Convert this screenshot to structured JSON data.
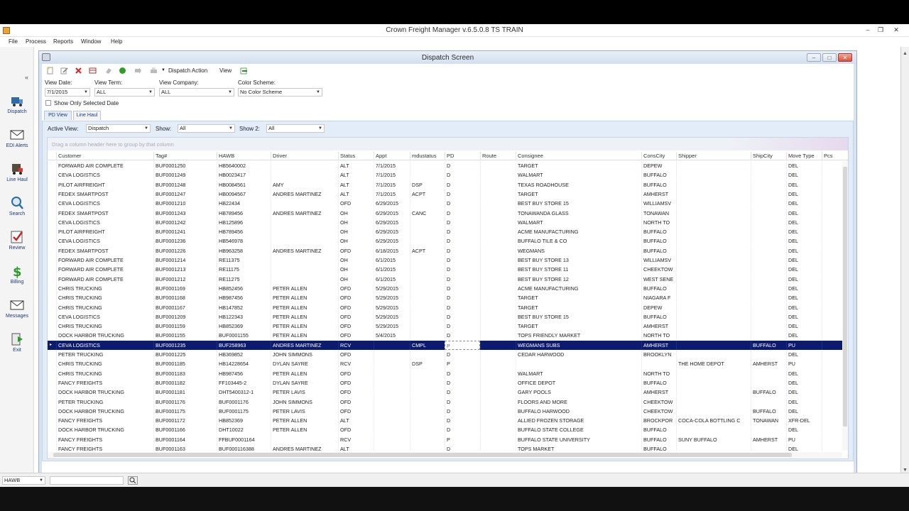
{
  "app": {
    "title": "Crown Freight Manager v.6.5.0.8 TS TRAIN",
    "menu": [
      "File",
      "Process",
      "Reports",
      "Window",
      "Help"
    ]
  },
  "sidebar": {
    "items": [
      {
        "label": "Dispatch",
        "icon": "dispatch-truck-icon"
      },
      {
        "label": "EDI Alerts",
        "icon": "envelope-icon"
      },
      {
        "label": "Line Haul",
        "icon": "line-haul-icon"
      },
      {
        "label": "Search",
        "icon": "search-icon"
      },
      {
        "label": "Review",
        "icon": "checklist-icon"
      },
      {
        "label": "Billing",
        "icon": "dollar-icon"
      },
      {
        "label": "Messages",
        "icon": "envelope-icon"
      },
      {
        "label": "Exit",
        "icon": "exit-icon"
      }
    ]
  },
  "dispatch": {
    "title": "Dispatch Screen",
    "toolbar": {
      "dispatch_action": "Dispatch Action",
      "view": "View"
    },
    "filters": {
      "view_date_label": "View Date:",
      "view_date": "7/1/2015",
      "view_term_label": "View Term:",
      "view_term": "ALL",
      "view_company_label": "View Company:",
      "view_company": "ALL",
      "color_scheme_label": "Color Scheme:",
      "color_scheme": "No Color Scheme",
      "show_only_selected": "Show Only Selected Date"
    },
    "tabs": [
      "PD View",
      "Line Haul"
    ],
    "active_view_label": "Active View:",
    "active_view": "Dispatch",
    "show_label": "Show:",
    "show": "All",
    "show2_label": "Show 2:",
    "show2": "All",
    "group_hint": "Drag a column header here to group by that column",
    "columns": [
      "Customer",
      "Tag#",
      "HAWB",
      "Driver",
      "Status",
      "Appt",
      "mdustatus",
      "PD",
      "Route",
      "Consignee",
      "ConsCity",
      "Shipper",
      "ShipCity",
      "Move Type",
      "Pcs"
    ],
    "rows": [
      [
        "FORWARD AIR COMPLETE",
        "BUF0001250",
        "HB5640002",
        "",
        "ALT",
        "7/1/2015",
        "",
        "D",
        "",
        "TARGET",
        "DEPEW",
        "",
        "",
        "DEL",
        ""
      ],
      [
        "CEVA LOGISTICS",
        "BUF0001249",
        "HB0023417",
        "",
        "ALT",
        "7/1/2015",
        "",
        "D",
        "",
        "WALMART",
        "BUFFALO",
        "",
        "",
        "DEL",
        ""
      ],
      [
        "PILOT AIRFREIGHT",
        "BUF0001248",
        "HB0084561",
        "AMY",
        "ALT",
        "7/1/2015",
        "DSP",
        "D",
        "",
        "TEXAS ROADHOUSE",
        "BUFFALO",
        "",
        "",
        "DEL",
        ""
      ],
      [
        "FEDEX SMARTPOST",
        "BUF0001247",
        "HB0094567",
        "ANDRES MARTINEZ",
        "ALT",
        "7/1/2015",
        "ACPT",
        "D",
        "",
        "TARGET",
        "AMHERST",
        "",
        "",
        "DEL",
        ""
      ],
      [
        "CEVA LOGISTICS",
        "BUF0001210",
        "HB22434",
        "",
        "OFD",
        "6/29/2015",
        "",
        "D",
        "",
        "BEST BUY STORE 15",
        "WILLIAMSV",
        "",
        "",
        "DEL",
        ""
      ],
      [
        "FEDEX SMARTPOST",
        "BUF0001243",
        "HB789456",
        "ANDRES MARTINEZ",
        "OH",
        "6/29/2015",
        "CANC",
        "D",
        "",
        "TONAWANDA GLASS",
        "TONAWAN",
        "",
        "",
        "DEL",
        ""
      ],
      [
        "CEVA LOGISTICS",
        "BUF0001242",
        "HB125896",
        "",
        "OH",
        "6/29/2015",
        "",
        "D",
        "",
        "WALMART",
        "NORTH TO",
        "",
        "",
        "DEL",
        ""
      ],
      [
        "PILOT AIRFREIGHT",
        "BUF0001241",
        "HB789456",
        "",
        "OH",
        "6/29/2015",
        "",
        "D",
        "",
        "ACME MANUFACTURING",
        "BUFFALO",
        "",
        "",
        "DEL",
        ""
      ],
      [
        "CEVA LOGISTICS",
        "BUF0001236",
        "HB546978",
        "",
        "OH",
        "6/29/2015",
        "",
        "D",
        "",
        "BUFFALO TILE & CO",
        "BUFFALO",
        "",
        "",
        "DEL",
        ""
      ],
      [
        "FEDEX SMARTPOST",
        "BUF0001226",
        "HB963258",
        "ANDRES MARTINEZ",
        "OFD",
        "6/18/2015",
        "ACPT",
        "D",
        "",
        "WEGMANS",
        "BUFFALO",
        "",
        "",
        "DEL",
        ""
      ],
      [
        "FORWARD AIR COMPLETE",
        "BUF0001214",
        "RE11375",
        "",
        "OH",
        "6/1/2015",
        "",
        "D",
        "",
        "BEST BUY STORE 13",
        "WILLIAMSV",
        "",
        "",
        "DEL",
        ""
      ],
      [
        "FORWARD AIR COMPLETE",
        "BUF0001213",
        "RE11175",
        "",
        "OH",
        "6/1/2015",
        "",
        "D",
        "",
        "BEST BUY STORE 11",
        "CHEEKTOW",
        "",
        "",
        "DEL",
        ""
      ],
      [
        "FORWARD AIR COMPLETE",
        "BUF0001212",
        "RE11275",
        "",
        "OH",
        "6/1/2015",
        "",
        "D",
        "",
        "BEST BUY STORE 12",
        "WEST SENE",
        "",
        "",
        "DEL",
        ""
      ],
      [
        "CHRIS TRUCKING",
        "BUF0001169",
        "HB852456",
        "PETER ALLEN",
        "OFD",
        "5/29/2015",
        "",
        "D",
        "",
        "ACME MANUFACTURING",
        "BUFFALO",
        "",
        "",
        "DEL",
        ""
      ],
      [
        "CHRIS TRUCKING",
        "BUF0001168",
        "HB987456",
        "PETER ALLEN",
        "OFD",
        "5/29/2015",
        "",
        "D",
        "",
        "TARGET",
        "NIAGARA F",
        "",
        "",
        "DEL",
        ""
      ],
      [
        "CHRIS TRUCKING",
        "BUF0001167",
        "HB147852",
        "PETER ALLEN",
        "OFD",
        "5/29/2015",
        "",
        "D",
        "",
        "TARGET",
        "DEPEW",
        "",
        "",
        "DEL",
        ""
      ],
      [
        "CEVA LOGISTICS",
        "BUF0001209",
        "HB122343",
        "PETER ALLEN",
        "OFD",
        "5/29/2015",
        "",
        "D",
        "",
        "BEST BUY STORE 15",
        "BUFFALO",
        "",
        "",
        "DEL",
        ""
      ],
      [
        "CHRIS TRUCKING",
        "BUF0001159",
        "HB852369",
        "PETER ALLEN",
        "OFD",
        "5/29/2015",
        "",
        "D",
        "",
        "TARGET",
        "AMHERST",
        "",
        "",
        "DEL",
        ""
      ],
      [
        "DOCK HARBOR TRUCKING",
        "BUF0001155",
        "BUF0001155",
        "PETER ALLEN",
        "OFD",
        "5/4/2015",
        "",
        "D",
        "",
        "TOPS FRIENDLY MARKET",
        "NORTH TO",
        "",
        "",
        "DEL",
        ""
      ],
      [
        "CEVA LOGISTICS",
        "BUF0001235",
        "BUF258963",
        "ANDRES MARTINEZ",
        "RCV",
        "",
        "CMPL",
        "P",
        "",
        "WEGMANS SUBS",
        "AMHERST",
        "",
        "BUFFALO",
        "PU",
        ""
      ],
      [
        "PETER TRUCKING",
        "BUF0001225",
        "HB369852",
        "JOHN SIMMONS",
        "OFD",
        "",
        "",
        "D",
        "",
        "CEDAR HARWOOD",
        "BROOKLYN",
        "",
        "",
        "DEL",
        ""
      ],
      [
        "CHRIS TRUCKING",
        "BUF0001185",
        "HB14228654",
        "DYLAN SAYRE",
        "RCV",
        "",
        "DSP",
        "P",
        "",
        "",
        "",
        "THE HOME DEPOT",
        "AMHERST",
        "PU",
        ""
      ],
      [
        "CHRIS TRUCKING",
        "BUF0001183",
        "HB987456",
        "PETER ALLEN",
        "OFD",
        "",
        "",
        "D",
        "",
        "WALMART",
        "NORTH TO",
        "",
        "",
        "DEL",
        ""
      ],
      [
        "FANCY FREIGHTS",
        "BUF0001182",
        "FF103445-2",
        "DYLAN SAYRE",
        "OFD",
        "",
        "",
        "D",
        "",
        "OFFICE DEPOT",
        "BUFFALO",
        "",
        "",
        "DEL",
        ""
      ],
      [
        "DOCK HARBOR TRUCKING",
        "BUF0001181",
        "DHT5400312-1",
        "PETER LAVIS",
        "OFD",
        "",
        "",
        "D",
        "",
        "GARY POOLS",
        "AMHERST",
        "",
        "BUFFALO",
        "DEL",
        ""
      ],
      [
        "PETER TRUCKING",
        "BUF0001176",
        "BUF0001176",
        "JOHN SIMMONS",
        "OFD",
        "",
        "",
        "D",
        "",
        "FLOORS AND MORE",
        "CHEEKTOW",
        "",
        "",
        "DEL",
        ""
      ],
      [
        "DOCK HARBOR TRUCKING",
        "BUF0001175",
        "BUF0001175",
        "PETER LAVIS",
        "OFD",
        "",
        "",
        "D",
        "",
        "BUFFALO HARWOOD",
        "CHEEKTOW",
        "",
        "BUFFALO",
        "DEL",
        ""
      ],
      [
        "FANCY FREIGHTS",
        "BUF0001172",
        "HB852369",
        "PETER ALLEN",
        "ALT",
        "",
        "",
        "D",
        "",
        "ALLIED FROZEN STORAGE",
        "BROCKPOR",
        "COCA-COLA BOTTLING C",
        "TONAWAN",
        "XFR-DEL",
        ""
      ],
      [
        "DOCK HARBOR TRUCKING",
        "BUF0001166",
        "DHT10022",
        "PETER ALLEN",
        "OFD",
        "",
        "",
        "D",
        "",
        "BUFFALO STATE COLLEGE",
        "BUFFALO",
        "",
        "",
        "DEL",
        ""
      ],
      [
        "FANCY FREIGHTS",
        "BUF0001164",
        "FFBUF0001164",
        "",
        "RCV",
        "",
        "",
        "P",
        "",
        "BUFFALO STATE UNIVERSITY",
        "BUFFALO",
        "SUNY BUFFALO",
        "AMHERST",
        "PU",
        ""
      ],
      [
        "FANCY FREIGHTS",
        "BUF0001163",
        "BUF000116388",
        "ANDRES MARTINEZ",
        "ALT",
        "",
        "",
        "D",
        "",
        "TOPS MARKET",
        "BUFFALO",
        "",
        "",
        "DEL",
        ""
      ]
    ],
    "selected_row": 19
  },
  "statusbar": {
    "search_field": "HAWB",
    "search_value": ""
  }
}
